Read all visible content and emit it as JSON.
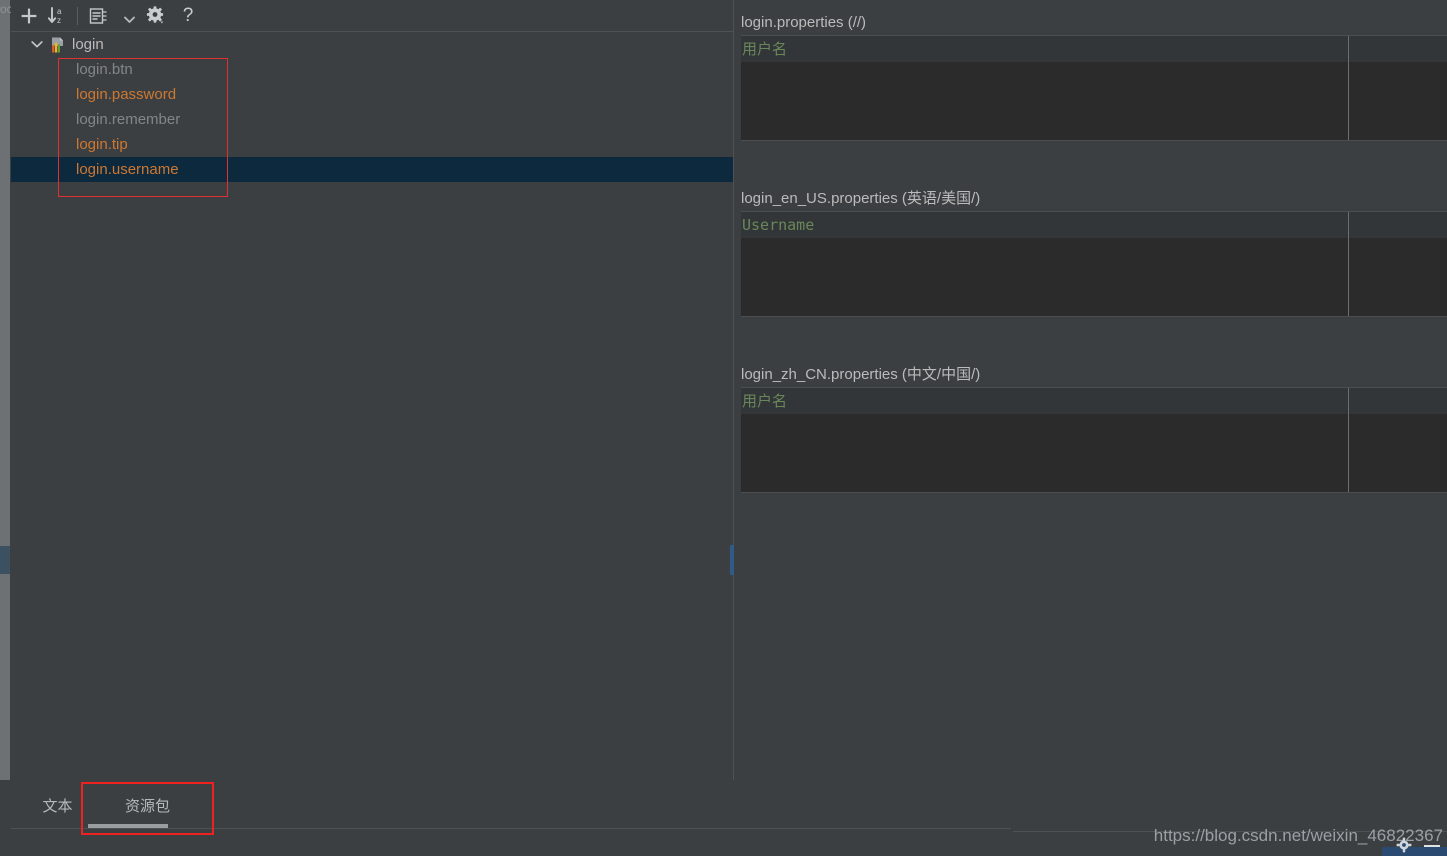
{
  "window": {
    "corner_fragment": "oc",
    "watermark": "https://blog.csdn.net/weixin_46822367"
  },
  "toolbar": {
    "add_label": "+",
    "sort_label": "sort-alphabetically",
    "properties_label": "show-properties",
    "dropdown_label": "more-options",
    "settings_label": "settings",
    "help_label": "?"
  },
  "tree": {
    "root": {
      "label": "login",
      "icon": "resource-bundle-icon",
      "expanded": true
    },
    "items": [
      {
        "label": "login.btn",
        "state": "dim",
        "selected": false
      },
      {
        "label": "login.password",
        "state": "resolved",
        "selected": false
      },
      {
        "label": "login.remember",
        "state": "dim",
        "selected": false
      },
      {
        "label": "login.tip",
        "state": "resolved",
        "selected": false
      },
      {
        "label": "login.username",
        "state": "resolved",
        "selected": true
      }
    ]
  },
  "editors": [
    {
      "title": "login.properties (//)",
      "value": "用户名"
    },
    {
      "title": "login_en_US.properties (英语/美国/)",
      "value": "Username"
    },
    {
      "title": "login_zh_CN.properties (中文/中国/)",
      "value": "用户名"
    }
  ],
  "tabs": [
    {
      "label": "文本",
      "active": false
    },
    {
      "label": "资源包",
      "active": true
    }
  ],
  "colors": {
    "background": "#3c3f41",
    "editor_background": "#2b2b2b",
    "selection": "#0d293e",
    "key_resolved": "#cc7832",
    "key_dim": "#838688",
    "value_text": "#6a8759",
    "highlight_box": "#e03131"
  }
}
